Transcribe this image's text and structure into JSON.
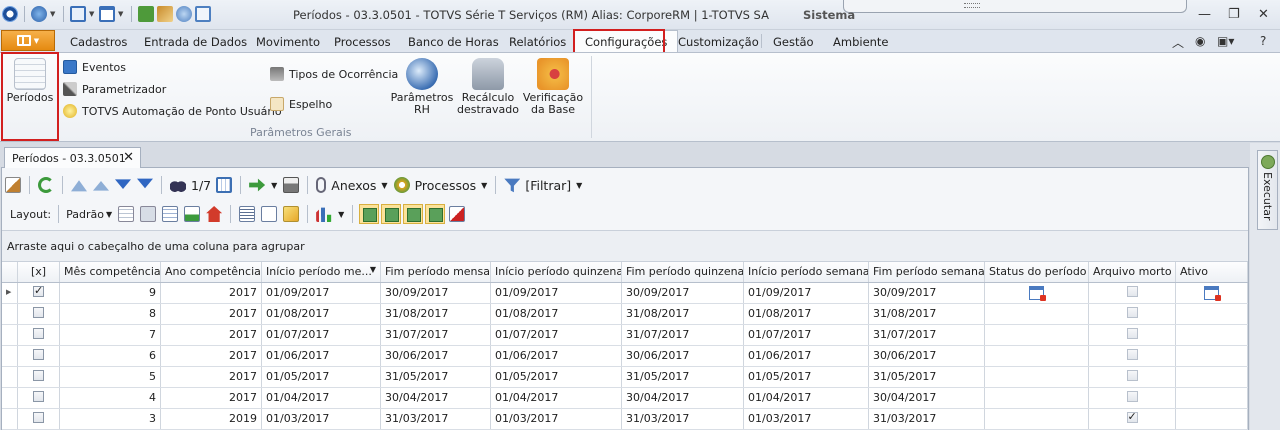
{
  "window": {
    "title": "Períodos - 03.3.0501 - TOTVS Série T Serviços (RM) Alias: CorporeRM | 1-TOTVS SA",
    "system_label": "Sistema"
  },
  "ribbon_tabs": [
    "Cadastros",
    "Entrada de Dados",
    "Movimento",
    "Processos",
    "Banco de Horas",
    "Relatórios",
    "Configurações",
    "Customização",
    "Gestão",
    "Ambiente"
  ],
  "active_tab": "Configurações",
  "ribbon": {
    "periodos": "Períodos",
    "eventos": "Eventos",
    "parametrizador": "Parametrizador",
    "automacao": "TOTVS Automação de Ponto Usuário",
    "tipos_ocorrencia": "Tipos de Ocorrência",
    "espelho": "Espelho",
    "parametros_rh_1": "Parâmetros",
    "parametros_rh_2": "RH",
    "recalculo_1": "Recálculo",
    "recalculo_2": "destravado",
    "verificacao_1": "Verificação",
    "verificacao_2": "da Base",
    "group_label": "Parâmetros Gerais"
  },
  "document_tab": "Períodos - 03.3.0501",
  "toolbar": {
    "record_counter": "1/7",
    "anexos": "Anexos",
    "processos": "Processos",
    "filtrar": "[Filtrar]",
    "layout_label": "Layout:",
    "layout_value": "Padrão"
  },
  "group_hint": "Arraste aqui o cabeçalho de uma coluna para agrupar",
  "executar": "Executar",
  "grid": {
    "columns": [
      "[x]",
      "Mês competência",
      "Ano competência",
      "Início período me...",
      "Fim período mensal",
      "Início período quinzenal",
      "Fim período quinzenal",
      "Início período semanal",
      "Fim período semanal",
      "Status do período",
      "Arquivo morto",
      "Ativo"
    ],
    "rows": [
      {
        "mes": "9",
        "ano": "2017",
        "ini_m": "01/09/2017",
        "fim_m": "30/09/2017",
        "ini_q": "01/09/2017",
        "fim_q": "30/09/2017",
        "ini_s": "01/09/2017",
        "fim_s": "30/09/2017"
      },
      {
        "mes": "8",
        "ano": "2017",
        "ini_m": "01/08/2017",
        "fim_m": "31/08/2017",
        "ini_q": "01/08/2017",
        "fim_q": "31/08/2017",
        "ini_s": "01/08/2017",
        "fim_s": "31/08/2017"
      },
      {
        "mes": "7",
        "ano": "2017",
        "ini_m": "01/07/2017",
        "fim_m": "31/07/2017",
        "ini_q": "01/07/2017",
        "fim_q": "31/07/2017",
        "ini_s": "01/07/2017",
        "fim_s": "31/07/2017"
      },
      {
        "mes": "6",
        "ano": "2017",
        "ini_m": "01/06/2017",
        "fim_m": "30/06/2017",
        "ini_q": "01/06/2017",
        "fim_q": "30/06/2017",
        "ini_s": "01/06/2017",
        "fim_s": "30/06/2017"
      },
      {
        "mes": "5",
        "ano": "2017",
        "ini_m": "01/05/2017",
        "fim_m": "31/05/2017",
        "ini_q": "01/05/2017",
        "fim_q": "31/05/2017",
        "ini_s": "01/05/2017",
        "fim_s": "31/05/2017"
      },
      {
        "mes": "4",
        "ano": "2017",
        "ini_m": "01/04/2017",
        "fim_m": "30/04/2017",
        "ini_q": "01/04/2017",
        "fim_q": "30/04/2017",
        "ini_s": "01/04/2017",
        "fim_s": "30/04/2017"
      },
      {
        "mes": "3",
        "ano": "2019",
        "ini_m": "01/03/2017",
        "fim_m": "31/03/2017",
        "ini_q": "01/03/2017",
        "fim_q": "31/03/2017",
        "ini_s": "01/03/2017",
        "fim_s": "31/03/2017"
      }
    ]
  }
}
